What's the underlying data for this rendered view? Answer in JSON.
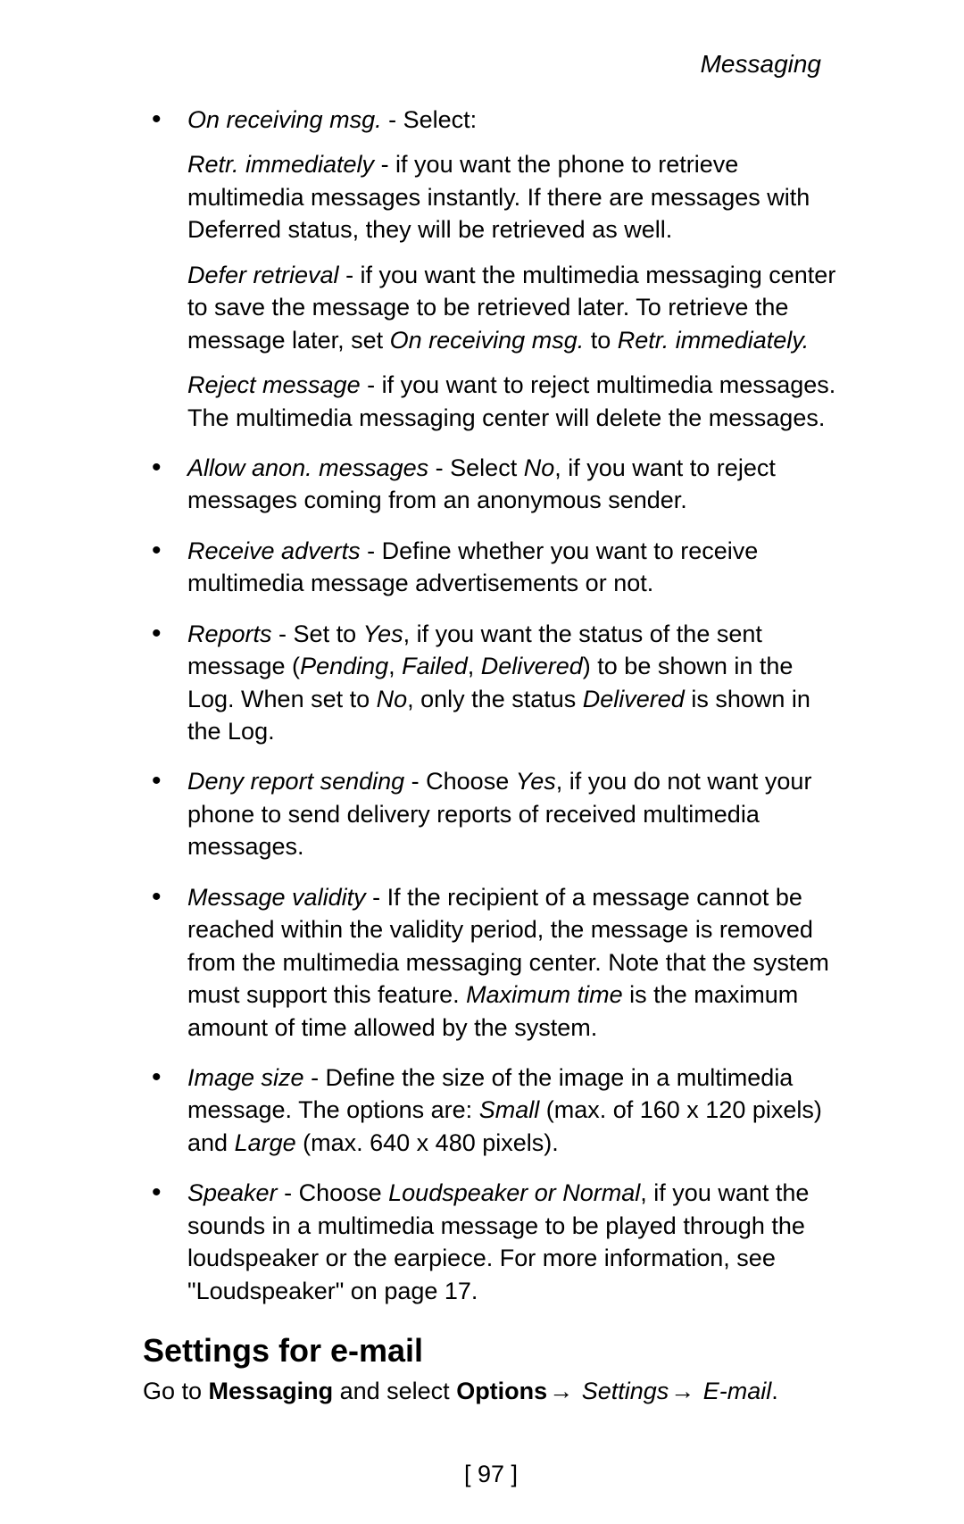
{
  "header": {
    "title": "Messaging"
  },
  "bullets": {
    "b1": {
      "lead": "On receiving msg.",
      "tail": " - Select:",
      "p1": {
        "lead": "Retr. immediately",
        "tail": " - if you want the phone to retrieve multimedia messages instantly. If there are messages with Deferred status, they will be retrieved as well."
      },
      "p2": {
        "lead": "Defer retrieval",
        "mid1": " - if you want the multimedia messaging center to save the message to be retrieved later. To retrieve the message later, set ",
        "em1": "On receiving msg.",
        "mid2": " to ",
        "em2": "Retr. immediately."
      },
      "p3": {
        "lead": "Reject message",
        "tail": " - if you want to reject multimedia messages. The multimedia messaging center will delete the messages."
      }
    },
    "b2": {
      "lead": "Allow anon. messages",
      "mid": " - Select ",
      "em": "No",
      "tail": ", if you want to reject messages coming from an anonymous sender."
    },
    "b3": {
      "lead": "Receive adverts",
      "tail": " - Define whether you want to receive multimedia message advertisements or not."
    },
    "b4": {
      "lead": "Reports",
      "mid1": " - Set to ",
      "em1": "Yes",
      "mid2": ", if you want the status of the sent message (",
      "em2": "Pending",
      "sep1": ", ",
      "em3": "Failed",
      "sep2": ", ",
      "em4": "Delivered",
      "mid3": ") to be shown in the Log. When set to ",
      "em5": "No",
      "mid4": ", only the status ",
      "em6": "Delivered",
      "tail": " is shown in the Log."
    },
    "b5": {
      "lead": "Deny report sending",
      "mid": " - Choose ",
      "em": "Yes",
      "tail": ", if you do not want your phone to send delivery reports of received multimedia messages."
    },
    "b6": {
      "lead": "Message validity",
      "mid1": " - If the recipient of a message cannot be reached within the validity period, the message is removed from the multimedia messaging center. Note that the system must support this feature. ",
      "em1": "Maximum time",
      "tail": " is the maximum amount of time allowed by the system."
    },
    "b7": {
      "lead": "Image size",
      "mid1": " - Define the size of the image in a multimedia message. The options are: ",
      "em1": "Small",
      "mid2": " (max. of 160 x 120 pixels) and ",
      "em2": "Large",
      "tail": " (max. 640 x 480 pixels)."
    },
    "b8": {
      "lead": "Speaker",
      "mid1": " - Choose ",
      "em1": "Loudspeaker or Normal",
      "tail": ", if you want the sounds in a multimedia message to be played through the loudspeaker or the earpiece. For more information, see \"Loudspeaker\" on page 17."
    }
  },
  "section": {
    "title": "Settings for e-mail"
  },
  "nav": {
    "pre": "Go to ",
    "s1": "Messaging",
    "mid1": " and select ",
    "s2": "Options",
    "arrow": "→",
    "s3": " Settings",
    "s4": " E-mail",
    "end": "."
  },
  "footer": {
    "page": "[ 97 ]"
  }
}
